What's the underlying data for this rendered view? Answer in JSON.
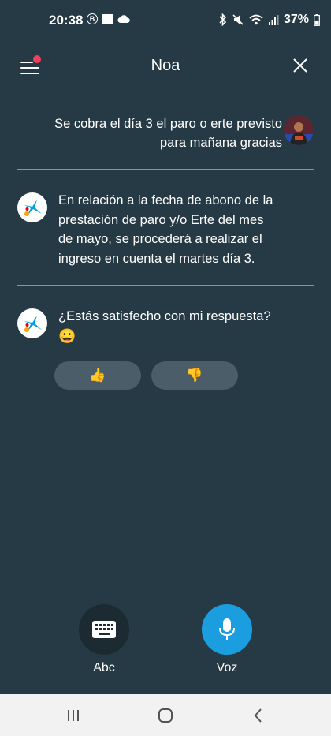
{
  "status_bar": {
    "time": "20:38",
    "b_badge": "B",
    "battery": "37%",
    "icons": [
      "b-circle-icon",
      "square-icon",
      "cloud-icon",
      "bluetooth-icon",
      "mute-icon",
      "wifi-icon",
      "signal-icon",
      "battery-icon"
    ]
  },
  "header": {
    "title": "Noa",
    "menu_icon": "menu-icon",
    "notification_color": "#f0405a",
    "close_icon": "close-icon"
  },
  "conversation": {
    "user_message": {
      "line1": "Se cobra el día 3 el paro o erte previsto",
      "line2": "para mañana gracias"
    },
    "bot_message": {
      "line1": "En relación a la fecha de abono de la",
      "line2": "prestación de paro y/o Erte del mes",
      "line3": "de mayo, se procederá a realizar el",
      "line4": "ingreso en cuenta el martes día 3."
    },
    "bot_question": {
      "text": "¿Estás satisfecho con mi respuesta?",
      "emoji": "😀"
    },
    "feedback": {
      "thumbs_up": "👍",
      "thumbs_down": "👎"
    }
  },
  "input_modes": {
    "keyboard_label": "Abc",
    "voice_label": "Voz",
    "voice_color": "#1a9ee0"
  },
  "nav": {
    "icons": [
      "recent-apps-icon",
      "home-icon",
      "back-icon"
    ]
  },
  "colors": {
    "background": "#253a45",
    "brand_blue": "#009fe3"
  }
}
